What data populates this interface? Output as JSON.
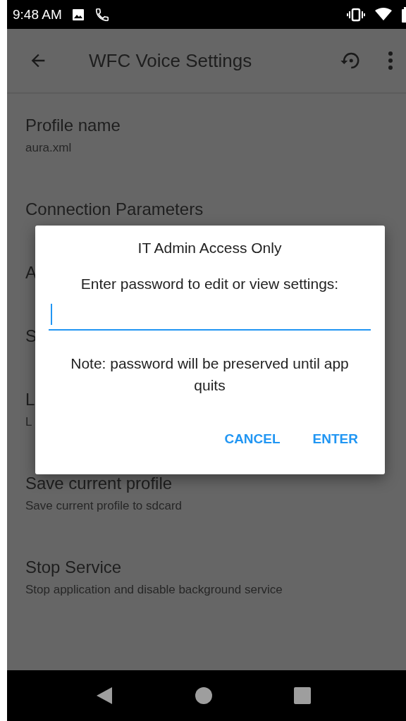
{
  "status_bar": {
    "time": "9:48 AM"
  },
  "toolbar": {
    "title": "WFC Voice Settings"
  },
  "settings": [
    {
      "title": "Profile name",
      "subtitle": "aura.xml"
    },
    {
      "title": "Connection Parameters"
    },
    {
      "title": "A"
    },
    {
      "title": "S"
    },
    {
      "title": "L",
      "subtitle": "L"
    },
    {
      "title": "Save current profile",
      "subtitle": "Save current profile to sdcard"
    },
    {
      "title": "Stop Service",
      "subtitle": "Stop application and disable background service"
    }
  ],
  "dialog": {
    "title": "IT Admin Access Only",
    "prompt": "Enter password to edit or view settings:",
    "password_field": {
      "focused": true
    },
    "note": "Note: password will be preserved until app quits",
    "buttons": [
      "CANCEL",
      "ENTER"
    ]
  }
}
